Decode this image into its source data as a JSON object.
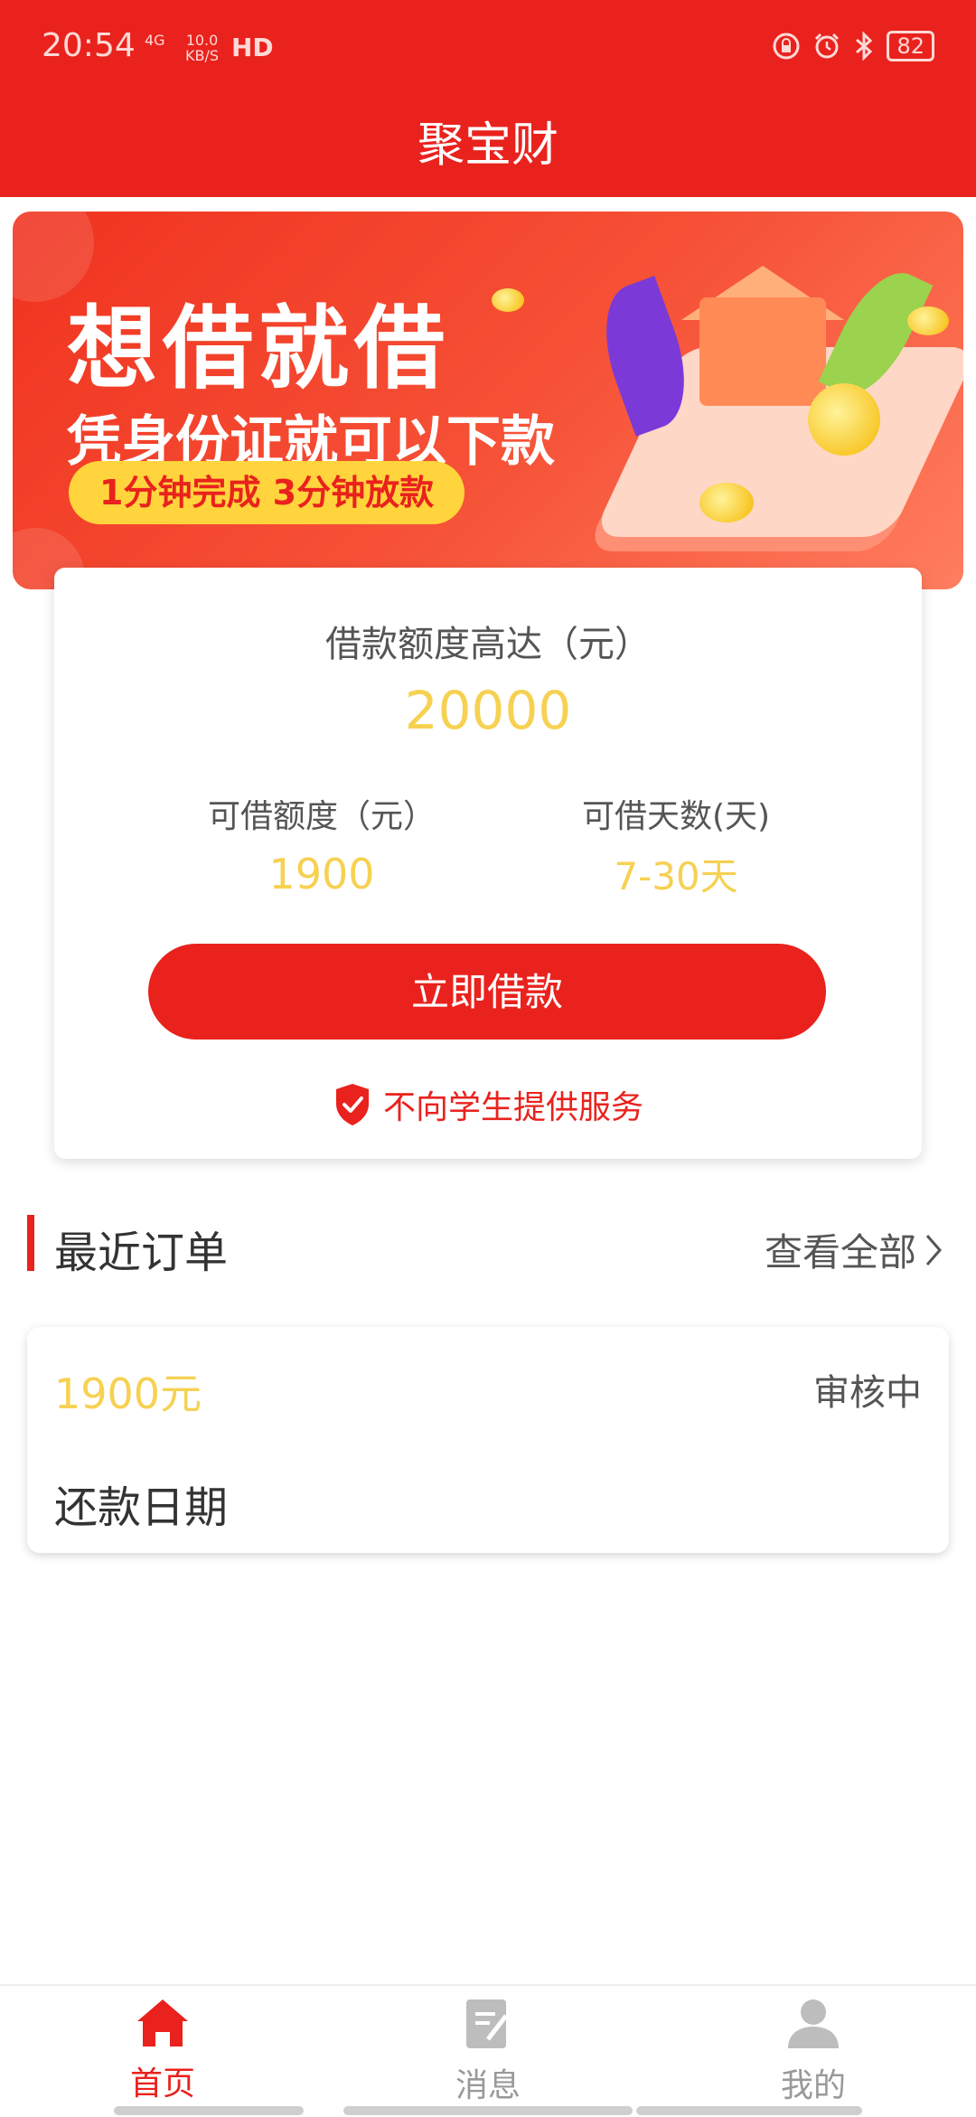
{
  "status_bar": {
    "time": "20:54",
    "network": "4G",
    "speed_value": "10.0",
    "speed_unit": "KB/S",
    "hd": "HD",
    "battery": "82"
  },
  "header": {
    "title": "聚宝财"
  },
  "banner": {
    "headline": "想借就借",
    "subheadline": "凭身份证就可以下款",
    "pill": "1分钟完成 3分钟放款"
  },
  "loan_card": {
    "max_label": "借款额度高达（元）",
    "max_value": "20000",
    "available_label": "可借额度（元）",
    "available_value": "1900",
    "days_label": "可借天数(天)",
    "days_value": "7-30天",
    "button_label": "立即借款",
    "notice": "不向学生提供服务"
  },
  "recent_orders": {
    "title": "最近订单",
    "view_all": "查看全部",
    "orders": [
      {
        "amount": "1900元",
        "status": "审核中",
        "date_label": "还款日期"
      }
    ]
  },
  "bottom_nav": {
    "items": [
      {
        "label": "首页",
        "icon": "home-icon",
        "active": true
      },
      {
        "label": "消息",
        "icon": "message-icon",
        "active": false
      },
      {
        "label": "我的",
        "icon": "profile-icon",
        "active": false
      }
    ]
  },
  "colors": {
    "primary": "#e9221d",
    "accent_yellow": "#f6d152",
    "text": "#333333"
  }
}
